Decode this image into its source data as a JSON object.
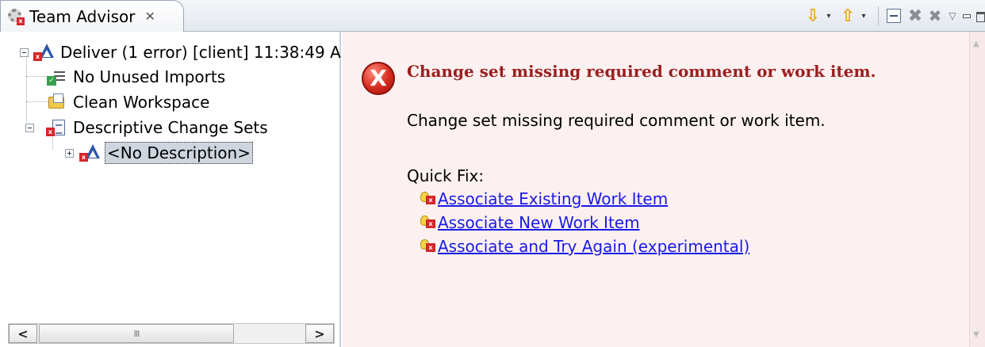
{
  "tab": {
    "title": "Team Advisor",
    "close_glyph": "✕",
    "icon": "team-advisor-error-icon"
  },
  "toolbar": {
    "next_glyph": "⇩",
    "prev_glyph": "⇧",
    "dropdown_glyph": "▾",
    "remove_glyph": "✖",
    "remove_all_glyph": "✖",
    "menu_glyph": "▽"
  },
  "tree": {
    "root": {
      "label": "Deliver (1 error) [client] 11:38:49 A",
      "icon": "deliver-error-icon"
    },
    "items": [
      {
        "label": "No Unused Imports",
        "icon": "check-passed-icon"
      },
      {
        "label": "Clean Workspace",
        "icon": "workspace-passed-icon"
      },
      {
        "label": "Descriptive Change Sets",
        "icon": "change-set-error-icon"
      }
    ],
    "child": {
      "label": "<No Description>",
      "icon": "change-set-item-error-icon"
    }
  },
  "scrollbar": {
    "thumb_grip": "III",
    "left_glyph": "<",
    "right_glyph": ">"
  },
  "detail": {
    "error_glyph": "X",
    "heading": "Change set missing required comment or work item.",
    "description": "Change set missing required comment or work item.",
    "quick_fix_label": "Quick Fix:",
    "quick_fixes": [
      "Associate Existing Work Item",
      "Associate New Work Item",
      "Associate and Try Again (experimental)"
    ]
  },
  "colors": {
    "detail_background": "#fcf0f0",
    "heading": "#9b1f1f",
    "link": "#1a1ae6",
    "error": "#d6262a"
  }
}
